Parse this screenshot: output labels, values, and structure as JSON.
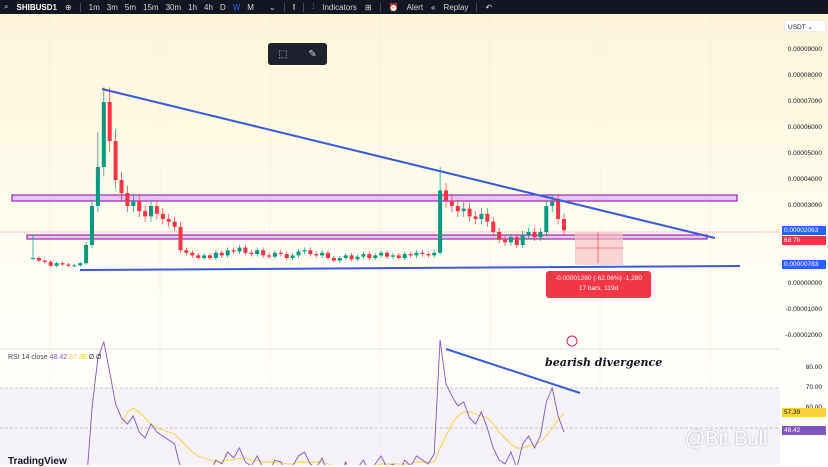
{
  "toolbar": {
    "symbol": "SHIBUSD1",
    "intervals": [
      "1m",
      "3m",
      "5m",
      "15m",
      "30m",
      "1h",
      "4h",
      "D",
      "W",
      "M"
    ],
    "active_interval": "W",
    "indicators": "Indicators",
    "alert": "Alert",
    "replay": "Replay"
  },
  "price_axis": {
    "currency": "USDT",
    "ticks": [
      {
        "v": 9000,
        "l": "0.00009000"
      },
      {
        "v": 8000,
        "l": "0.00008000"
      },
      {
        "v": 7000,
        "l": "0.00007000"
      },
      {
        "v": 6000,
        "l": "0.00006000"
      },
      {
        "v": 5000,
        "l": "0.00005000"
      },
      {
        "v": 4000,
        "l": "0.00004000"
      },
      {
        "v": 3000,
        "l": "0.00003000"
      },
      {
        "v": 0,
        "l": "0.00000000"
      },
      {
        "v": -1000,
        "l": "-0.00001000"
      },
      {
        "v": -2000,
        "l": "-0.00002000"
      }
    ],
    "current_price": "0.00002063",
    "countdown": "6d 7h",
    "line_price": "0.00000783"
  },
  "measure": {
    "line1": "-0.00001280 (-62.06%) -1,280",
    "line2": "17 bars, 119d"
  },
  "rsi": {
    "title": "RSI 14 close",
    "value": "48.42",
    "ma": "57.39",
    "extra": "Ø Ø",
    "ticks": [
      "80.00",
      "70.00",
      "60.00"
    ]
  },
  "annotation": "bearish divergence",
  "watermark": "@Bit Bull",
  "logo": "TradingView",
  "colors": {
    "up": "#089981",
    "down": "#f23645",
    "trend": "#3b5bdb",
    "zone": "#9c27b0",
    "rsi": "#7e57c2",
    "rsi_ma": "#f7d23d"
  },
  "closes": [
    1000,
    900,
    850,
    700,
    800,
    750,
    700,
    720,
    800,
    1500,
    3000,
    4500,
    7000,
    5500,
    4000,
    3500,
    3000,
    3200,
    2800,
    2600,
    3000,
    2700,
    2500,
    2400,
    2200,
    1300,
    1200,
    1100,
    1000,
    1100,
    1000,
    1200,
    1100,
    1300,
    1250,
    1400,
    1200,
    1150,
    1300,
    1100,
    1050,
    1200,
    1150,
    1000,
    1100,
    1250,
    1300,
    1150,
    1100,
    1200,
    1000,
    900,
    1000,
    1100,
    950,
    1050,
    1150,
    1000,
    1100,
    1200,
    1050,
    1100,
    1000,
    1150,
    1100,
    1200,
    1150,
    1100,
    1200,
    3600,
    3200,
    3000,
    2800,
    2900,
    2600,
    2500,
    2700,
    2400,
    2000,
    1700,
    1600,
    1800,
    1500,
    1900,
    2000,
    1800,
    2000,
    3000,
    3200,
    2500,
    2063
  ],
  "rsi_series": [
    null,
    null,
    null,
    null,
    null,
    null,
    null,
    null,
    null,
    20,
    60,
    85,
    93,
    78,
    62,
    55,
    52,
    56,
    48,
    45,
    52,
    48,
    46,
    44,
    42,
    30,
    26,
    24,
    22,
    30,
    28,
    34,
    32,
    38,
    35,
    40,
    33,
    31,
    36,
    30,
    28,
    34,
    33,
    27,
    31,
    36,
    38,
    32,
    30,
    35,
    27,
    22,
    27,
    33,
    25,
    30,
    34,
    28,
    32,
    36,
    30,
    32,
    27,
    34,
    31,
    36,
    34,
    32,
    37,
    94,
    72,
    66,
    61,
    63,
    55,
    52,
    58,
    50,
    40,
    34,
    32,
    38,
    30,
    42,
    46,
    40,
    46,
    63,
    70,
    56,
    48
  ],
  "rsi_ma": [
    null,
    null,
    null,
    null,
    null,
    null,
    null,
    null,
    null,
    null,
    null,
    null,
    null,
    null,
    null,
    52,
    58,
    60,
    58,
    55,
    52,
    50,
    49,
    48,
    47,
    44,
    41,
    38,
    36,
    35,
    34,
    33,
    33,
    34,
    34,
    35,
    35,
    34,
    34,
    33,
    33,
    33,
    33,
    32,
    32,
    33,
    33,
    33,
    33,
    33,
    32,
    31,
    30,
    30,
    30,
    30,
    31,
    31,
    31,
    32,
    32,
    32,
    32,
    32,
    32,
    33,
    33,
    33,
    33,
    40,
    46,
    52,
    56,
    58,
    58,
    57,
    56,
    55,
    52,
    48,
    45,
    42,
    40,
    40,
    41,
    42,
    43,
    46,
    50,
    54,
    57.39
  ]
}
